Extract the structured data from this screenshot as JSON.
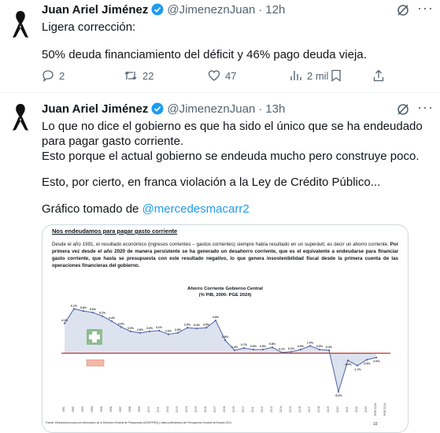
{
  "tweets": [
    {
      "author_name": "Juan Ariel Jiménez",
      "handle": "@JimeneznJuan",
      "separator": "·",
      "time": "12h",
      "text_lines": [
        "Ligera corrección:",
        "",
        "50% deuda financiamiento del déficit y 46% pago deuda vieja."
      ],
      "actions": {
        "replies": "2",
        "reposts": "22",
        "likes": "47",
        "views": "2 mil"
      }
    },
    {
      "author_name": "Juan Ariel Jiménez",
      "handle": "@JimeneznJuan",
      "separator": "·",
      "time": "13h",
      "text_lines": [
        "Lo que no dice el gobierno es que ha sido el único que se ha endeudado",
        "para pagar gasto corriente.",
        "Esto porque el actual gobierno se endeuda mucho pero construye poco.",
        "",
        "Esto, por cierto, en franca violación a la Ley de Crédito Público...",
        "",
        "Gráfico tomado de"
      ],
      "mention": "@mercedesmacarr2"
    }
  ],
  "card": {
    "title": "Nos endeudamos para pagar gasto corriente",
    "para_plain": "Desde el año 1991, el resultado económico (ingresos corrientes – gastos corrientes) siempre había resultado en un superávit, es decir un ahorro corriente. ",
    "para_bold": "Por primera vez desde el año 2020 de manera persistente se ha generado un desahorro corriente, que es el equivalente a endeudarse para financiar gasto corriente, que hasta se presupuesta con este resultado negativo, lo que genera  insostenibilidad fiscal desde la primera cuenta de las operaciones financieras del gobierno.",
    "chart_title_1": "Ahorro Corriente Gobierno Central",
    "chart_title_2": "(% PIB, 2000- PGE 2024)",
    "footnote": "Fuente: Elaboración propia con información de la Dirección General de Presupuesto (DIGEPRES) y datos preliminares del Presupuesto General del Estado 2024",
    "page_number": "10"
  },
  "chart_data": {
    "type": "line",
    "title": "Ahorro Corriente Gobierno Central",
    "subtitle": "(% PIB, 2000- PGE 2024)",
    "categories": [
      "1991",
      "1992",
      "1993",
      "1994",
      "1995",
      "1996",
      "1997",
      "1998",
      "1999",
      "2000",
      "2001",
      "2002",
      "2003",
      "2004",
      "2005",
      "2006",
      "2007",
      "2008",
      "2009",
      "2010",
      "2011",
      "2012",
      "2013",
      "2014",
      "2015",
      "2016",
      "2017",
      "2018",
      "2019",
      "2020",
      "2021",
      "2022",
      "2023",
      "PGE 2024",
      "PGE 2024"
    ],
    "value_labels": [
      "4.1%",
      "6.1%",
      "5.8%",
      "5.6%",
      "5.1%",
      "4.4%",
      "3.6%",
      "3.0%",
      "2.8%",
      "3.0%",
      "3.1%",
      "2.6%",
      "2.8%",
      "3.5%",
      "3.4%",
      "3.5%",
      "4.5%",
      "1.8%",
      "0.4%",
      "0.7%",
      "0.5%",
      "0.5%",
      "0.8%",
      "0.1%",
      "0.2%",
      "0.5%",
      "1.0%",
      "0.5%",
      "0.4%",
      "-5.3%",
      "-1.0%",
      "-1.7%",
      "-0.9%",
      "-0.6%",
      ""
    ],
    "values": [
      4.1,
      6.1,
      5.8,
      5.6,
      5.1,
      4.4,
      3.6,
      3.0,
      2.8,
      3.0,
      3.1,
      2.6,
      2.8,
      3.5,
      3.4,
      3.5,
      4.5,
      1.8,
      0.4,
      0.7,
      0.5,
      0.5,
      0.8,
      0.1,
      0.2,
      0.5,
      1.0,
      0.5,
      0.4,
      -5.3,
      -1.0,
      -1.7,
      -0.9,
      -0.6,
      null
    ],
    "ylim": [
      -6,
      7
    ],
    "colors": {
      "line": "#5a6fa8",
      "fill": "#dde2ef",
      "zero_line": "#c0392b",
      "plus_box": "#8fbc8f",
      "minus_box": "#f2b8a8"
    }
  },
  "colors": {
    "link": "#1d9bf0",
    "muted": "#536471",
    "verified": "#1d9bf0"
  }
}
